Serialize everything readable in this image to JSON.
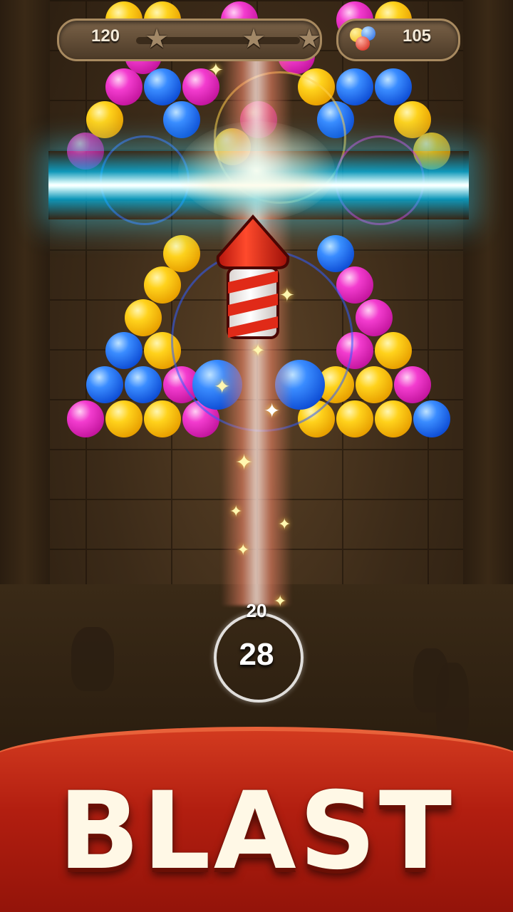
{
  "hud": {
    "score": "120",
    "stars_earned": 0,
    "stars_total": 3,
    "coins": "105"
  },
  "shooter": {
    "next_value": "20",
    "shots_left": "28"
  },
  "banner": {
    "title": "BLAST"
  },
  "active_booster": "rocket-icon",
  "bubble_colors": [
    "yellow",
    "blue",
    "magenta"
  ],
  "colors": {
    "banner_red": "#b21e10",
    "laser_cyan": "#3ad8ff",
    "star_inactive": "#a28867"
  }
}
